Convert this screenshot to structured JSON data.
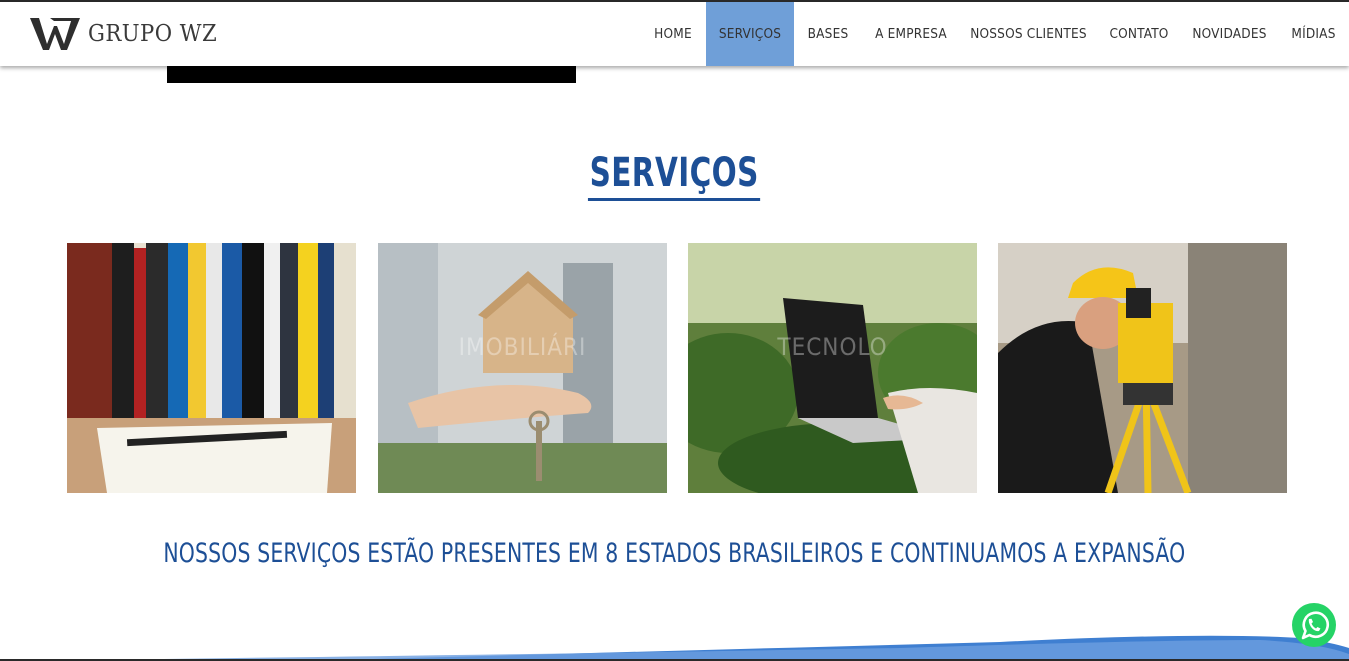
{
  "header": {
    "logo_text": "GRUPO WZ",
    "logo_icon": "wz-monogram-icon"
  },
  "nav": {
    "items": [
      {
        "label": "HOME"
      },
      {
        "label": "SERVIÇOS",
        "active": true
      },
      {
        "label": "BASES"
      },
      {
        "label": "A EMPRESA"
      },
      {
        "label": "NOSSOS CLIENTES"
      },
      {
        "label": "CONTATO"
      },
      {
        "label": "NOVIDADES"
      },
      {
        "label": "MÍDIAS"
      }
    ],
    "active_color": "#6f9fd8"
  },
  "main": {
    "title": "SERVIÇOS",
    "cards": [
      {
        "watermark": ""
      },
      {
        "watermark": "IMOBILIÁRI"
      },
      {
        "watermark": "TECNOLO"
      },
      {
        "watermark": ""
      }
    ],
    "tagline": "NOSSOS SERVIÇOS ESTÃO PRESENTES EM 8 ESTADOS BRASILEIROS E CONTINUAMOS A EXPANSÃO"
  },
  "colors": {
    "brand_blue": "#1d4f96",
    "whatsapp_green": "#25d366"
  },
  "floating": {
    "whatsapp_icon": "whatsapp-icon"
  }
}
